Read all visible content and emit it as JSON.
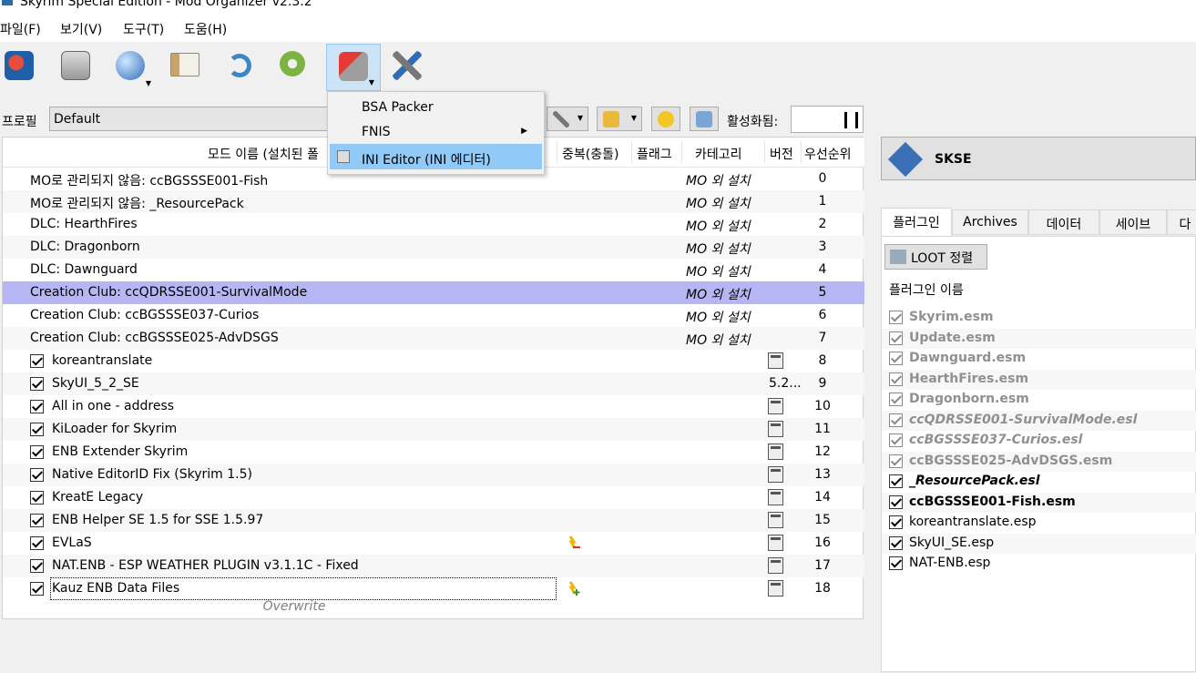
{
  "window": {
    "title": "Skyrim Special Edition - Mod Organizer v2.3.2"
  },
  "menu": [
    "파일(F)",
    "보기(V)",
    "도구(T)",
    "도움(H)"
  ],
  "dropdown": {
    "items": [
      "BSA Packer",
      "FNIS",
      "INI Editor (INI 에디터)"
    ],
    "highlighted": "INI Editor (INI 에디터)"
  },
  "profile": {
    "label": "프로필",
    "value": "Default",
    "active_label": "활성화됨:"
  },
  "columns": {
    "name": "모드 이름 (설치된 폴",
    "conflicts": "중복(충돌)",
    "flags": "플래그",
    "category": "카테고리",
    "version": "버전",
    "priority": "우선순위"
  },
  "mods": [
    {
      "name": "MO로 관리되지 않음: ccBGSSSE001-Fish",
      "category": "MO 외 설치",
      "priority": "0",
      "checkbox": false
    },
    {
      "name": "MO로 관리되지 않음: _ResourcePack",
      "category": "MO 외 설치",
      "priority": "1",
      "checkbox": false
    },
    {
      "name": "DLC: HearthFires",
      "category": "MO 외 설치",
      "priority": "2",
      "checkbox": false
    },
    {
      "name": "DLC: Dragonborn",
      "category": "MO 외 설치",
      "priority": "3",
      "checkbox": false
    },
    {
      "name": "DLC: Dawnguard",
      "category": "MO 외 설치",
      "priority": "4",
      "checkbox": false
    },
    {
      "name": "Creation Club: ccQDRSSE001-SurvivalMode",
      "category": "MO 외 설치",
      "priority": "5",
      "checkbox": false,
      "selected": true
    },
    {
      "name": "Creation Club: ccBGSSSE037-Curios",
      "category": "MO 외 설치",
      "priority": "6",
      "checkbox": false
    },
    {
      "name": "Creation Club: ccBGSSSE025-AdvDSGS",
      "category": "MO 외 설치",
      "priority": "7",
      "checkbox": false
    },
    {
      "name": "koreantranslate",
      "priority": "8",
      "checkbox": true,
      "calendar": true
    },
    {
      "name": "SkyUI_5_2_SE",
      "version": "5.2...",
      "priority": "9",
      "checkbox": true
    },
    {
      "name": "All in one - address",
      "priority": "10",
      "checkbox": true,
      "calendar": true
    },
    {
      "name": "KiLoader for Skyrim",
      "priority": "11",
      "checkbox": true,
      "calendar": true
    },
    {
      "name": "ENB Extender Skyrim",
      "priority": "12",
      "checkbox": true,
      "calendar": true
    },
    {
      "name": "Native EditorID Fix (Skyrim 1.5)",
      "priority": "13",
      "checkbox": true,
      "calendar": true
    },
    {
      "name": "KreatE Legacy",
      "priority": "14",
      "checkbox": true,
      "calendar": true
    },
    {
      "name": "ENB Helper SE 1.5 for SSE 1.5.97",
      "priority": "15",
      "checkbox": true,
      "calendar": true
    },
    {
      "name": "EVLaS",
      "priority": "16",
      "checkbox": true,
      "calendar": true,
      "conflict": "overwritten"
    },
    {
      "name": "NAT.ENB - ESP WEATHER PLUGIN v3.1.1C - Fixed",
      "priority": "17",
      "checkbox": true,
      "calendar": true
    },
    {
      "name": "Kauz ENB Data Files",
      "priority": "18",
      "checkbox": true,
      "calendar": true,
      "conflict": "overwrites",
      "focused": true
    }
  ],
  "overwrite_label": "Overwrite",
  "executable": {
    "name": "SKSE"
  },
  "tabs": [
    "플러그인",
    "Archives",
    "데이터",
    "세이브",
    "다"
  ],
  "loot_button": "LOOT 정렬",
  "plugins_header": "플러그인 이름",
  "plugins": [
    {
      "name": "Skyrim.esm",
      "style": "grey"
    },
    {
      "name": "Update.esm",
      "style": "grey"
    },
    {
      "name": "Dawnguard.esm",
      "style": "grey"
    },
    {
      "name": "HearthFires.esm",
      "style": "grey"
    },
    {
      "name": "Dragonborn.esm",
      "style": "grey"
    },
    {
      "name": "ccQDRSSE001-SurvivalMode.esl",
      "style": "greyi"
    },
    {
      "name": "ccBGSSSE037-Curios.esl",
      "style": "greyi"
    },
    {
      "name": "ccBGSSSE025-AdvDSGS.esm",
      "style": "grey"
    },
    {
      "name": "_ResourcePack.esl",
      "style": "bi"
    },
    {
      "name": "ccBGSSSE001-Fish.esm",
      "style": "b"
    },
    {
      "name": "koreantranslate.esp",
      "style": ""
    },
    {
      "name": "SkyUI_SE.esp",
      "style": ""
    },
    {
      "name": "NAT-ENB.esp",
      "style": ""
    }
  ],
  "icons": [
    "install-mod-icon",
    "profiles-icon",
    "nexus-globe-icon",
    "executables-icon",
    "refresh-icon",
    "settings-icon",
    "tools-puzzle-icon",
    "wrench-icon"
  ],
  "colors": {
    "selection": "#b6b6f5",
    "menu_highlight": "#91c9f7",
    "toolbar_active": "#cce4f7"
  }
}
